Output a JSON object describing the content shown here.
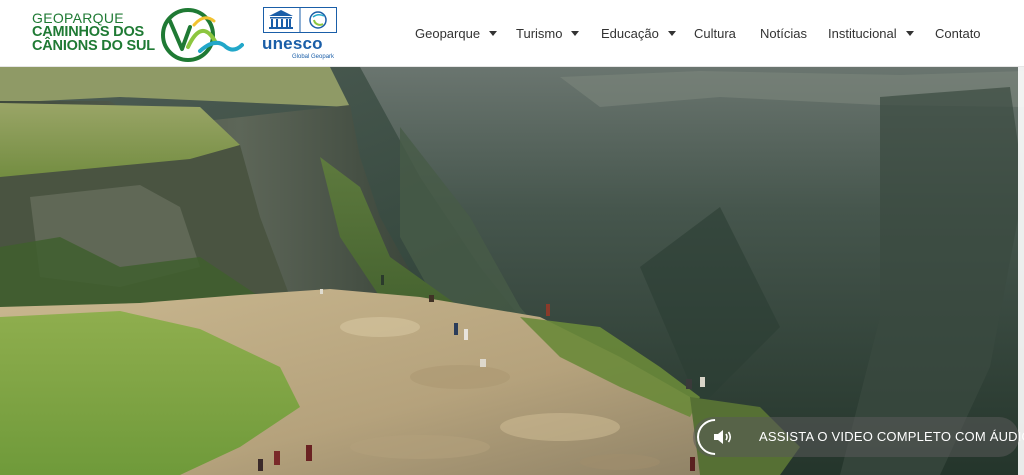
{
  "brand": {
    "line1": "GEOPARQUE",
    "line2": "CAMINHOS DOS",
    "line3": "CÂNIONS DO SUL",
    "logo_icon": "geopark-cv-logo-icon"
  },
  "unesco": {
    "word": "unesco",
    "subtitle": "Global Geopark",
    "emblem_icon": "unesco-temple-emblem-icon"
  },
  "nav": {
    "items": [
      {
        "label": "Geoparque",
        "has_dropdown": true
      },
      {
        "label": "Turismo",
        "has_dropdown": true
      },
      {
        "label": "Educação",
        "has_dropdown": true
      },
      {
        "label": "Cultura",
        "has_dropdown": false
      },
      {
        "label": "Notícias",
        "has_dropdown": false
      },
      {
        "label": "Institucional",
        "has_dropdown": true
      },
      {
        "label": "Contato",
        "has_dropdown": false
      }
    ]
  },
  "hero": {
    "video_button_label": "ASSISTA O VIDEO COMPLETO COM ÁUDIO",
    "video_button_icon": "speaker-icon"
  },
  "colors": {
    "brand_green": "#1f7a34",
    "unesco_blue": "#1a5ea8",
    "nav_text": "#333333"
  }
}
